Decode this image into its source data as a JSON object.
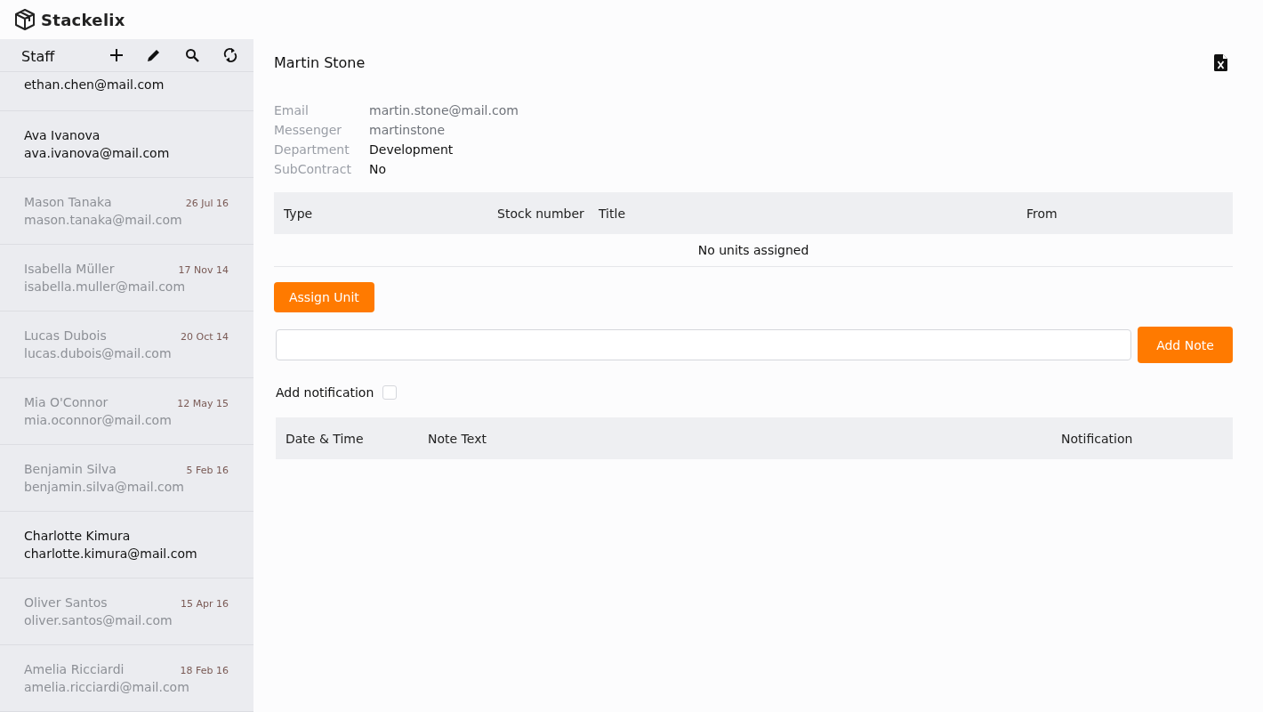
{
  "app": {
    "name": "Stackelix"
  },
  "sidebar": {
    "title": "Staff",
    "items": [
      {
        "email": "ethan.chen@mail.com",
        "inactive": false
      },
      {
        "name": "Ava Ivanova",
        "email": "ava.ivanova@mail.com",
        "inactive": false
      },
      {
        "name": "Mason Tanaka",
        "email": "mason.tanaka@mail.com",
        "date": "26 Jul 16",
        "inactive": true
      },
      {
        "name": "Isabella Müller",
        "email": "isabella.muller@mail.com",
        "date": "17 Nov 14",
        "inactive": true
      },
      {
        "name": "Lucas Dubois",
        "email": "lucas.dubois@mail.com",
        "date": "20 Oct 14",
        "inactive": true
      },
      {
        "name": "Mia O'Connor",
        "email": "mia.oconnor@mail.com",
        "date": "12 May 15",
        "inactive": true
      },
      {
        "name": "Benjamin Silva",
        "email": "benjamin.silva@mail.com",
        "date": "5 Feb 16",
        "inactive": true
      },
      {
        "name": "Charlotte Kimura",
        "email": "charlotte.kimura@mail.com",
        "inactive": false
      },
      {
        "name": "Oliver Santos",
        "email": "oliver.santos@mail.com",
        "date": "15 Apr 16",
        "inactive": true
      },
      {
        "name": "Amelia Ricciardi",
        "email": "amelia.ricciardi@mail.com",
        "date": "18 Feb 16",
        "inactive": true
      }
    ]
  },
  "detail": {
    "title": "Martin Stone",
    "fields": [
      {
        "label": "Email",
        "value": "martin.stone@mail.com",
        "muted": true
      },
      {
        "label": "Messenger",
        "value": "martinstone",
        "muted": true
      },
      {
        "label": "Department",
        "value": "Development",
        "muted": false
      },
      {
        "label": "SubContract",
        "value": "No",
        "muted": false
      }
    ]
  },
  "units_table": {
    "columns": [
      "Type",
      "Stock number",
      "Title",
      "From"
    ],
    "empty_text": "No units assigned"
  },
  "assign_button": "Assign Unit",
  "note": {
    "add_button": "Add Note",
    "notification_label": "Add notification",
    "notification_checked": false
  },
  "notes_table": {
    "columns": [
      "Date & Time",
      "Note Text",
      "Notification"
    ]
  }
}
